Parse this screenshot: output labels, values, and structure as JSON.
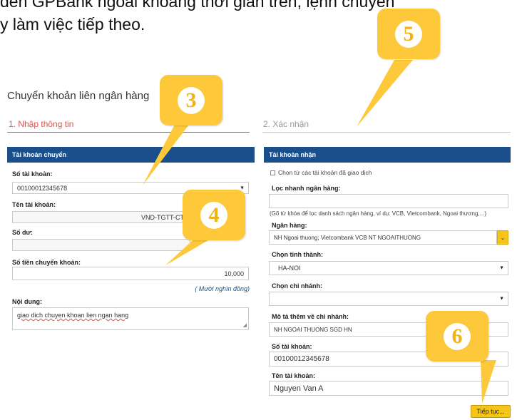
{
  "intro": {
    "line1": "đến GPBank ngoài khoảng thời gian trên, lệnh chuyển",
    "line2": "y làm việc tiếp theo."
  },
  "page_title": "Chuyển khoản liên ngân hàng",
  "steps": {
    "step1": "1. Nhập thông tin",
    "step2": "2. Xác nhận"
  },
  "source": {
    "header": "Tài khoản chuyển",
    "account_number_label": "Số tài khoản:",
    "account_number_value": "00100012345678",
    "account_name_label": "Tên tài khoản:",
    "account_name_value": "VND-TGTT-CT",
    "balance_label": "Số dư:",
    "balance_value": "",
    "amount_label": "Số tiền chuyển khoản:",
    "amount_value": "10,000",
    "amount_in_words": "( Mười nghìn đồng)",
    "content_label": "Nội dung:",
    "content_value": "giao dich chuyen khoan lien ngan hang"
  },
  "destination": {
    "header": "Tài khoản nhận",
    "pick_existing_label": "Chọn từ các tài khoản đã giao dịch",
    "bank_filter_label": "Lọc nhanh ngân hàng:",
    "bank_filter_value": "",
    "bank_filter_hint": "(Gõ từ khóa để lọc danh sách ngân hàng, ví dụ: VCB, Vietcombank, Ngoai thương,...)",
    "bank_label": "Ngân hàng:",
    "bank_value": "NH Ngoai thuong; Vietcombank VCB NT NGOAITHUONG",
    "province_label": "Chọn tỉnh thành:",
    "province_value": "HA-NOI",
    "branch_label": "Chọn chi nhánh:",
    "branch_value": "",
    "branch_desc_label": "Mô tả thêm về chi nhánh:",
    "branch_desc_value": "NH NGOAI THUONG SGD HN",
    "account_number_label": "Số tài khoản:",
    "account_number_value": "00100012345678",
    "account_name_label": "Tên tài khoản:",
    "account_name_value": "Nguyen Van A"
  },
  "next_button": "Tiếp tục...",
  "callouts": [
    "3",
    "4",
    "5",
    "6"
  ],
  "colors": {
    "header_blue": "#1a4f8b",
    "callout_yellow": "#fdc83a",
    "step_active_red": "#d9534f",
    "button_yellow": "#f5c518"
  },
  "icons": [
    "dropdown-caret-icon",
    "checkbox-icon",
    "resize-grip-icon",
    "search-toggle-icon"
  ]
}
